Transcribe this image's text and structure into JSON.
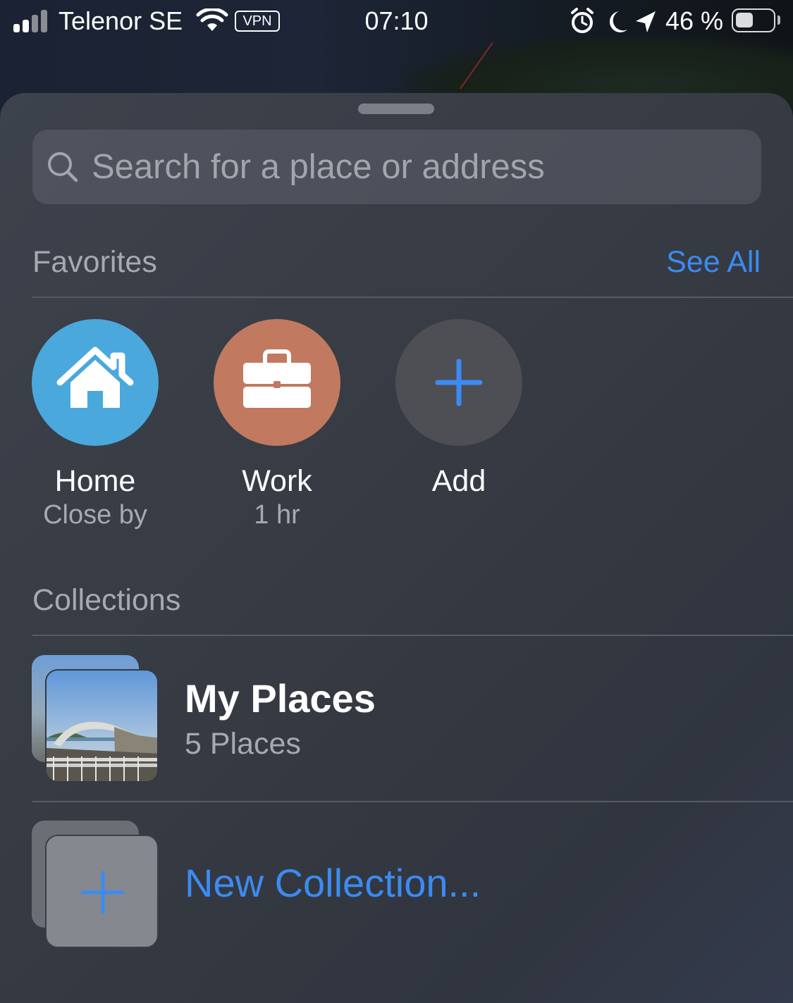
{
  "status_bar": {
    "carrier": "Telenor SE",
    "vpn": "VPN",
    "time": "07:10",
    "battery": "46 %",
    "icons": [
      "signal-icon",
      "wifi-icon",
      "alarm-icon",
      "moon-icon",
      "location-arrow-icon",
      "battery-icon"
    ]
  },
  "search": {
    "placeholder": "Search for a place or address"
  },
  "favorites": {
    "title": "Favorites",
    "see_all": "See All",
    "items": [
      {
        "label": "Home",
        "subtitle": "Close by",
        "icon": "house-icon",
        "color": "#4aa8dd"
      },
      {
        "label": "Work",
        "subtitle": "1 hr",
        "icon": "briefcase-icon",
        "color": "#c17960"
      },
      {
        "label": "Add",
        "subtitle": "",
        "icon": "plus-icon",
        "color": "#4d4f55"
      }
    ]
  },
  "collections": {
    "title": "Collections",
    "items": [
      {
        "title": "My Places",
        "subtitle": "5 Places",
        "icon": "bridge-photo"
      }
    ],
    "new_collection": "New Collection..."
  },
  "colors": {
    "accent": "#3b8bf2",
    "secondary_text": "#a6a9b0"
  }
}
